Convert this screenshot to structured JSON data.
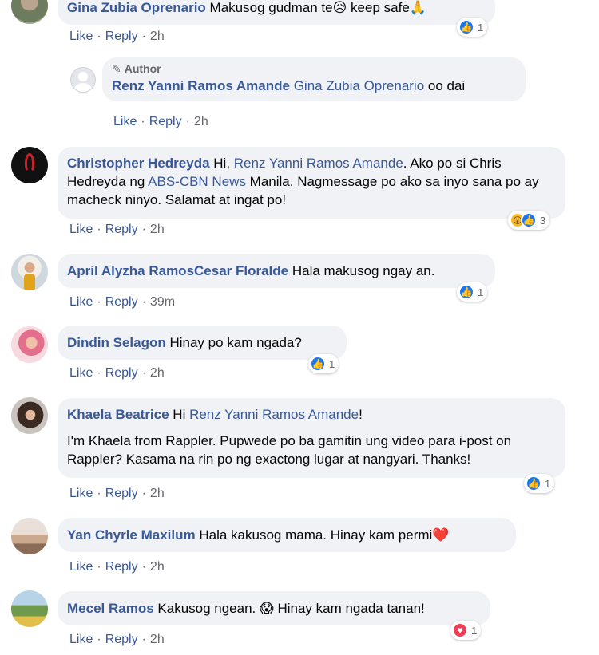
{
  "comments": [
    {
      "name": "Gina Zubia Oprenario",
      "text_a": "Makusog gudman te",
      "emoji_a": "😥",
      "text_b": " keep safe",
      "emoji_b": "🙏",
      "actions": {
        "like": "Like",
        "reply": "Reply",
        "time": "2h"
      },
      "reactions": {
        "icon": "like-icon",
        "count": "1"
      }
    },
    {
      "author_tag": "Author",
      "name": "Renz Yanni Ramos Amande",
      "mention": "Gina Zubia Oprenario",
      "text": " oo dai",
      "actions": {
        "like": "Like",
        "reply": "Reply",
        "time": "2h"
      }
    },
    {
      "name": "Christopher Hedreyda",
      "text_a": " Hi, ",
      "mention_a": "Renz Yanni Ramos Amande",
      "text_b": ". Ako po si Chris Hedreyda ng ",
      "mention_b": "ABS-CBN News",
      "text_c": " Manila. Nagmessage po ako sa inyo sana po ay macheck ninyo. Salamat at ingat po!",
      "actions": {
        "like": "Like",
        "reply": "Reply",
        "time": "2h"
      },
      "reactions": {
        "icons": [
          "wow-icon",
          "like-icon"
        ],
        "count": "3"
      }
    },
    {
      "name": "April Alyzha RamosCesar Floralde",
      "text": " Hala makusog ngay an.",
      "actions": {
        "like": "Like",
        "reply": "Reply",
        "time": "39m"
      },
      "reactions": {
        "icon": "like-icon",
        "count": "1"
      }
    },
    {
      "name": "Dindin Selagon",
      "text": " Hinay po kam ngada?",
      "actions": {
        "like": "Like",
        "reply": "Reply",
        "time": "2h"
      },
      "reactions": {
        "icon": "like-icon",
        "count": "1"
      }
    },
    {
      "name": "Khaela Beatrice",
      "text_a": " Hi ",
      "mention": "Renz Yanni Ramos Amande",
      "text_b": "!",
      "text_c": "I'm Khaela from Rappler. Pupwede po ba gamitin ung video para i-post on Rappler? Kasama na rin po ng exactong lugar at nangyari. Thanks!",
      "actions": {
        "like": "Like",
        "reply": "Reply",
        "time": "2h"
      },
      "reactions": {
        "icon": "like-icon",
        "count": "1"
      }
    },
    {
      "name": "Yan Chyrle Maxilum",
      "text": " Hala kakusog mama. Hinay kam permi",
      "emoji": "❤️",
      "actions": {
        "like": "Like",
        "reply": "Reply",
        "time": "2h"
      }
    },
    {
      "name": "Mecel Ramos",
      "text_a": " Kakusog ngean. ",
      "emoji": "😱",
      "text_b": " Hinay kam ngada tanan!",
      "actions": {
        "like": "Like",
        "reply": "Reply",
        "time": "2h"
      },
      "reactions": {
        "icon": "love-icon",
        "count": "1"
      }
    }
  ],
  "colors": {
    "name": "#385898",
    "bubble": "#f0f2f5",
    "meta": "#65676b",
    "like": "#1877f2",
    "love": "#f33e58",
    "wow": "#f7b928"
  }
}
